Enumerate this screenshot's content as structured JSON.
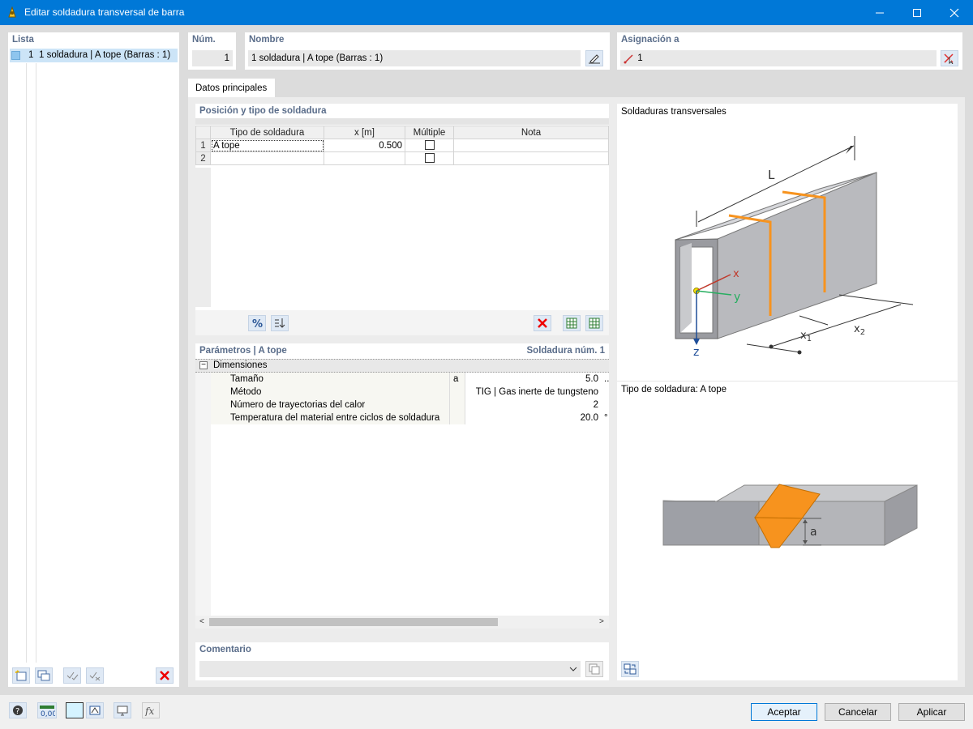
{
  "window": {
    "title": "Editar soldadura transversal de barra"
  },
  "list": {
    "header": "Lista",
    "items": [
      {
        "num": "1",
        "label": "1 soldadura | A tope (Barras : 1)"
      }
    ]
  },
  "num": {
    "header": "Núm.",
    "value": "1"
  },
  "name": {
    "header": "Nombre",
    "value": "1 soldadura | A tope (Barras : 1)"
  },
  "assign": {
    "header": "Asignación a",
    "value": "1"
  },
  "tabs": [
    {
      "label": "Datos principales"
    }
  ],
  "position": {
    "header": "Posición y tipo de soldadura",
    "columns": [
      "Tipo de soldadura",
      "x [m]",
      "Múltiple",
      "Nota"
    ],
    "rows": [
      {
        "n": "1",
        "type": "A tope",
        "x": "0.500",
        "note": ""
      },
      {
        "n": "2",
        "type": "",
        "x": "",
        "note": ""
      }
    ]
  },
  "params": {
    "header": "Parámetros | A tope",
    "right_header": "Soldadura núm. 1",
    "group": "Dimensiones",
    "rows": [
      {
        "label": "Tamaño",
        "sym": "a",
        "value": "5.0",
        "unit": ".."
      },
      {
        "label": "Método",
        "sym": "",
        "value": "TIG | Gas inerte de tungsteno",
        "unit": ""
      },
      {
        "label": "Número de trayectorias del calor",
        "sym": "",
        "value": "2",
        "unit": ""
      },
      {
        "label": "Temperatura del material entre ciclos de soldadura",
        "sym": "",
        "value": "20.0",
        "unit": "°"
      }
    ]
  },
  "comment": {
    "header": "Comentario",
    "value": ""
  },
  "preview": {
    "top_title": "Soldaduras transversales",
    "bottom_title": "Tipo de soldadura: A tope",
    "labels": {
      "L": "L",
      "x": "x",
      "y": "y",
      "z": "z",
      "x1": "x",
      "x1_sub": "1",
      "x2": "x",
      "x2_sub": "2",
      "a": "a"
    },
    "weld_color": "#f7931e"
  },
  "footer": {
    "ok": "Aceptar",
    "cancel": "Cancelar",
    "apply": "Aplicar",
    "units_value": "0,00"
  }
}
